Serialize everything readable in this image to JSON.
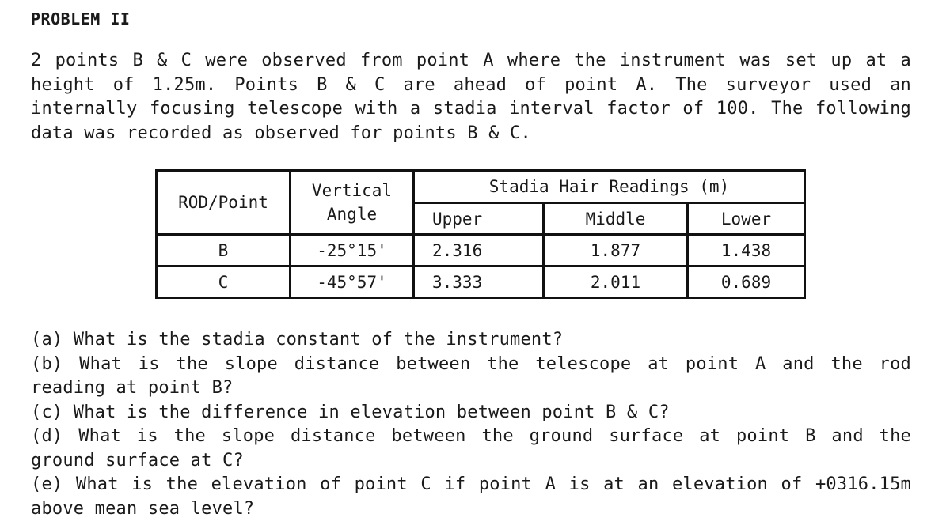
{
  "title": "PROBLEM II",
  "intro": "2 points B & C were observed from point A where the instrument was set up at a height of 1.25m. Points B & C are ahead of point A. The surveyor used an internally focusing telescope with a stadia interval factor of 100. The following data was recorded as observed for points B & C.",
  "table": {
    "headers": {
      "rod_point": "ROD/Point",
      "vertical_angle_line1": "Vertical",
      "vertical_angle_line2": "Angle",
      "stadia_group": "Stadia Hair Readings (m)",
      "upper": "Upper",
      "middle": "Middle",
      "lower": "Lower"
    },
    "rows": [
      {
        "point": "B",
        "vertical_angle": "-25°15'",
        "upper": "2.316",
        "middle": "1.877",
        "lower": "1.438"
      },
      {
        "point": "C",
        "vertical_angle": "-45°57'",
        "upper": "3.333",
        "middle": "2.011",
        "lower": "0.689"
      }
    ]
  },
  "questions": [
    "(a) What is the stadia constant of the instrument?",
    "(b) What is the slope distance between the telescope at point A and the rod reading at point B?",
    "(c) What is the difference in elevation between point B & C?",
    "(d) What is the slope distance between the ground surface at point B and the ground surface at C?",
    "(e) What is the elevation of point C if point A is at an elevation of +0316.15m above mean sea level?"
  ]
}
